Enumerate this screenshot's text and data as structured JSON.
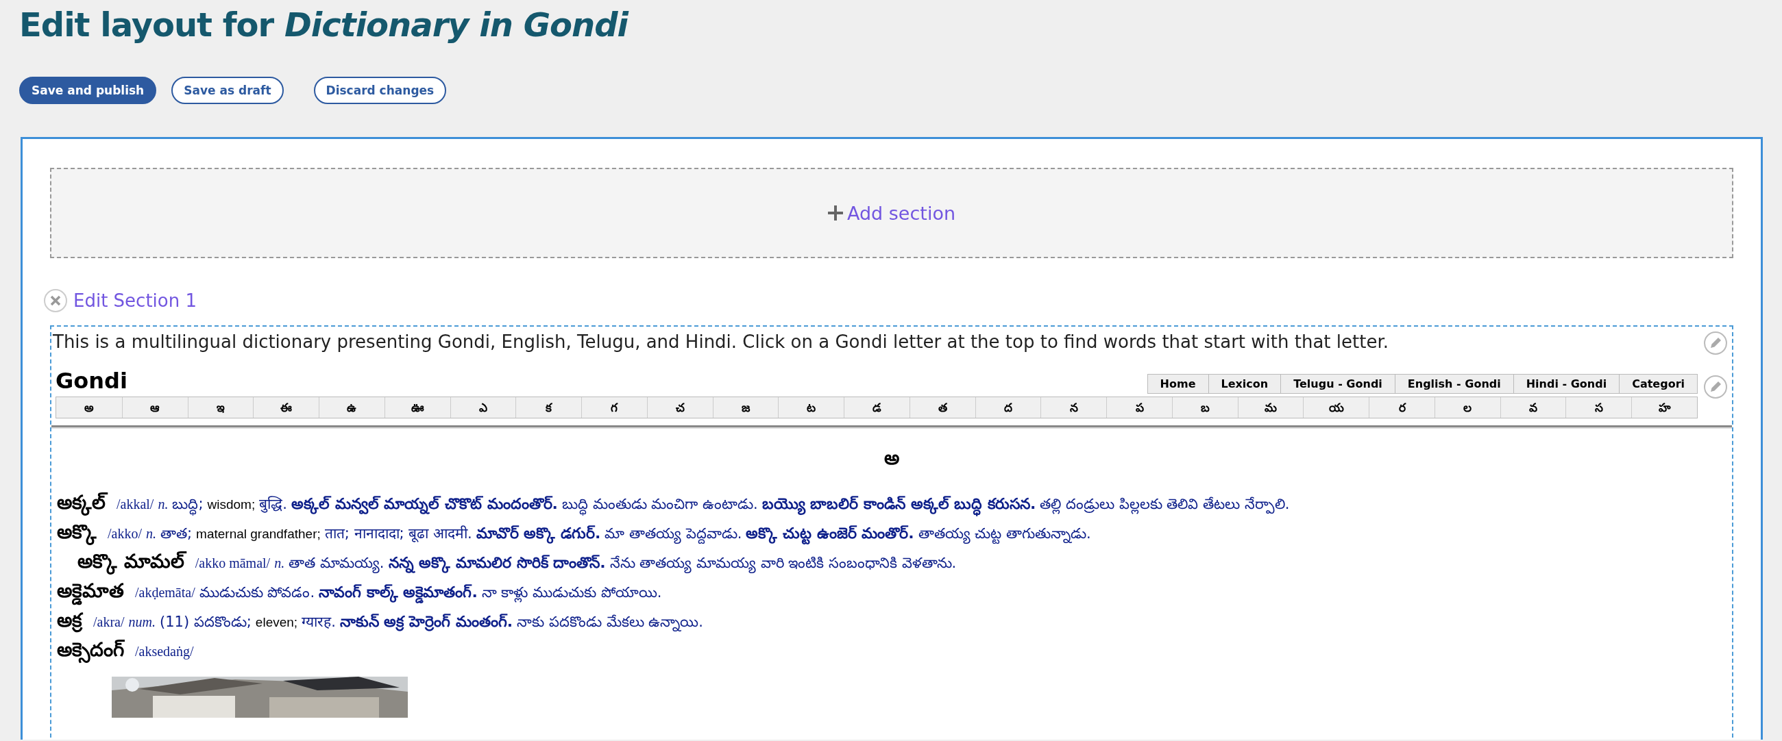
{
  "page_title": "Edit layout for *Dictionary in Gondi*",
  "buttons": [
    {
      "label": "Save and publish",
      "kind": "primary"
    },
    {
      "label": "Save as draft",
      "kind": "secondary"
    },
    {
      "label": "Discard changes",
      "kind": "secondary"
    }
  ],
  "add_section": {
    "label": "Add section"
  },
  "section": {
    "label": "Edit Section 1"
  },
  "intro": "This is a multilingual dictionary presenting Gondi, English, Telugu, and Hindi. Click on a Gondi letter at the top to find words that start with that letter.",
  "site": {
    "title": "Gondi",
    "nav": [
      "Home",
      "Lexicon",
      "Telugu - Gondi",
      "English - Gondi",
      "Hindi - Gondi",
      "Categori"
    ],
    "letters": [
      "అ",
      "ఆ",
      "ఇ",
      "ఈ",
      "ఉ",
      "ఊ",
      "ఎ",
      "క",
      "గ",
      "చ",
      "జ",
      "ట",
      "డ",
      "త",
      "ద",
      "న",
      "ప",
      "బ",
      "మ",
      "య",
      "ర",
      "ల",
      "వ",
      "స",
      "హ"
    ],
    "heading": "అ",
    "entries": [
      {
        "headword": "అక్కల్",
        "subentry": false,
        "parts": [
          {
            "kind": "pron",
            "text": "/akkal/"
          },
          {
            "kind": "pos",
            "text": "n."
          },
          {
            "kind": "gloss",
            "text": "బుద్ధి;"
          },
          {
            "kind": "english",
            "text": "wisdom;"
          },
          {
            "kind": "gloss",
            "text": "बुद्धि."
          },
          {
            "kind": "example",
            "text": "అక్కల్ మన్వల్ మాయ్నల్ చొకొట్ మందంతొర్."
          },
          {
            "kind": "gloss",
            "text": "బుద్ధి మంతుడు మంచిగా ఉంటాడు."
          },
          {
            "kind": "example",
            "text": "బయ్యొ బాబలిర్ కాండిన్ అక్కల్ బుద్ధి కరుసన."
          },
          {
            "kind": "gloss",
            "text": "తల్లి దండ్రులు పిల్లలకు తెలివి తేటలు నేర్పాలి."
          }
        ]
      },
      {
        "headword": "అక్కొ",
        "subentry": false,
        "parts": [
          {
            "kind": "pron",
            "text": "/akko/"
          },
          {
            "kind": "pos",
            "text": "n."
          },
          {
            "kind": "gloss",
            "text": "తాత;"
          },
          {
            "kind": "english",
            "text": "maternal grandfather;"
          },
          {
            "kind": "gloss",
            "text": "तात; नानादादा; बूढा आदमी."
          },
          {
            "kind": "example",
            "text": "మావొర్ అక్కొ డగుర్."
          },
          {
            "kind": "gloss",
            "text": "మా తాతయ్య పెద్దవాడు."
          },
          {
            "kind": "example",
            "text": "అక్కొ చుట్ట ఉంజెర్ మంతొర్."
          },
          {
            "kind": "gloss",
            "text": "తాతయ్య చుట్ట తాగుతున్నాడు."
          }
        ]
      },
      {
        "headword": "అక్కొ మామల్",
        "subentry": true,
        "parts": [
          {
            "kind": "pron",
            "text": "/akko māmal/"
          },
          {
            "kind": "pos",
            "text": "n."
          },
          {
            "kind": "gloss",
            "text": "తాత మామయ్య."
          },
          {
            "kind": "example",
            "text": "నన్న అక్కొ మామలిర సొరిక్ దాంతొన్."
          },
          {
            "kind": "gloss",
            "text": "నేను తాతయ్య మామయ్య వారి ఇంటికి సంబంధానికి వెళతాను."
          }
        ]
      },
      {
        "headword": "అక్డెమాత",
        "subentry": false,
        "parts": [
          {
            "kind": "pron",
            "text": "/akḍemāta/"
          },
          {
            "kind": "gloss",
            "text": "ముడుచుకు పోవడం."
          },
          {
            "kind": "example",
            "text": "నావంగ్ కాల్క్ అక్డెమాతంగ్."
          },
          {
            "kind": "gloss",
            "text": "నా కాళ్లు ముడుచుకు పోయాయి."
          }
        ]
      },
      {
        "headword": "అక్ర",
        "subentry": false,
        "parts": [
          {
            "kind": "pron",
            "text": "/akra/"
          },
          {
            "kind": "pos",
            "text": "num."
          },
          {
            "kind": "gloss",
            "text": "(11) పదకొండు;"
          },
          {
            "kind": "english",
            "text": "eleven;"
          },
          {
            "kind": "gloss",
            "text": "ग्यारह."
          },
          {
            "kind": "example",
            "text": "నాకున్ అక్ర హెర్రెంగ్ మంతంగ్."
          },
          {
            "kind": "gloss",
            "text": "నాకు పదకొండు మేకలు ఉన్నాయి."
          }
        ]
      },
      {
        "headword": "అక్సెదంగ్",
        "subentry": false,
        "parts": [
          {
            "kind": "pron",
            "text": "/aksedaṅg/"
          }
        ]
      }
    ]
  }
}
